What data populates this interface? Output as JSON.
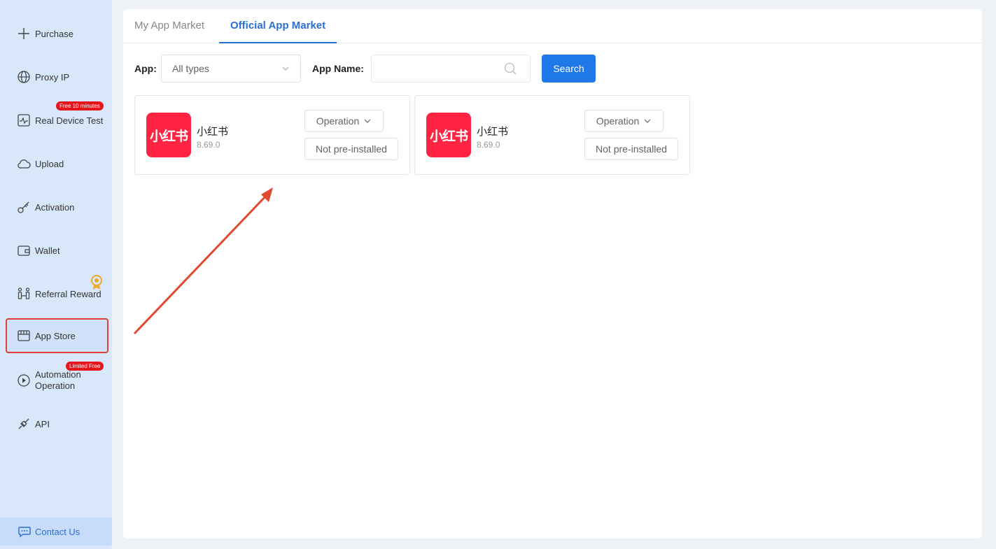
{
  "sidebar": {
    "items": [
      {
        "label": "Purchase",
        "icon": "plus-icon"
      },
      {
        "label": "Proxy IP",
        "icon": "globe-icon"
      },
      {
        "label": "Real Device Test",
        "icon": "device-test-icon",
        "badge": "Free 10 minutes"
      },
      {
        "label": "Upload",
        "icon": "cloud-upload-icon"
      },
      {
        "label": "Activation",
        "icon": "key-icon"
      },
      {
        "label": "Wallet",
        "icon": "wallet-icon"
      },
      {
        "label": "Referral Reward",
        "icon": "referral-icon"
      },
      {
        "label": "App Store",
        "icon": "store-icon",
        "active": true
      },
      {
        "label": "Automation Operation",
        "icon": "play-circle-icon",
        "badge": "Limited Free"
      },
      {
        "label": "API",
        "icon": "plug-icon"
      }
    ],
    "contact_label": "Contact Us"
  },
  "tabs": [
    {
      "label": "My App Market",
      "active": false
    },
    {
      "label": "Official App Market",
      "active": true
    }
  ],
  "filters": {
    "app_label": "App:",
    "app_value": "All types",
    "name_label": "App Name:",
    "name_value": "",
    "search_label": "Search"
  },
  "apps": [
    {
      "icon_text": "小红书",
      "name": "小红书",
      "version": "8.69.0",
      "operation_label": "Operation",
      "status_label": "Not pre-installed"
    },
    {
      "icon_text": "小红书",
      "name": "小红书",
      "version": "8.69.0",
      "operation_label": "Operation",
      "status_label": "Not pre-installed"
    }
  ],
  "colors": {
    "accent": "#1f78e8",
    "sidebar_bg": "#d9e7fb",
    "badge": "#e8141c",
    "highlight": "#e0403a",
    "app_icon": "#ff2442"
  }
}
